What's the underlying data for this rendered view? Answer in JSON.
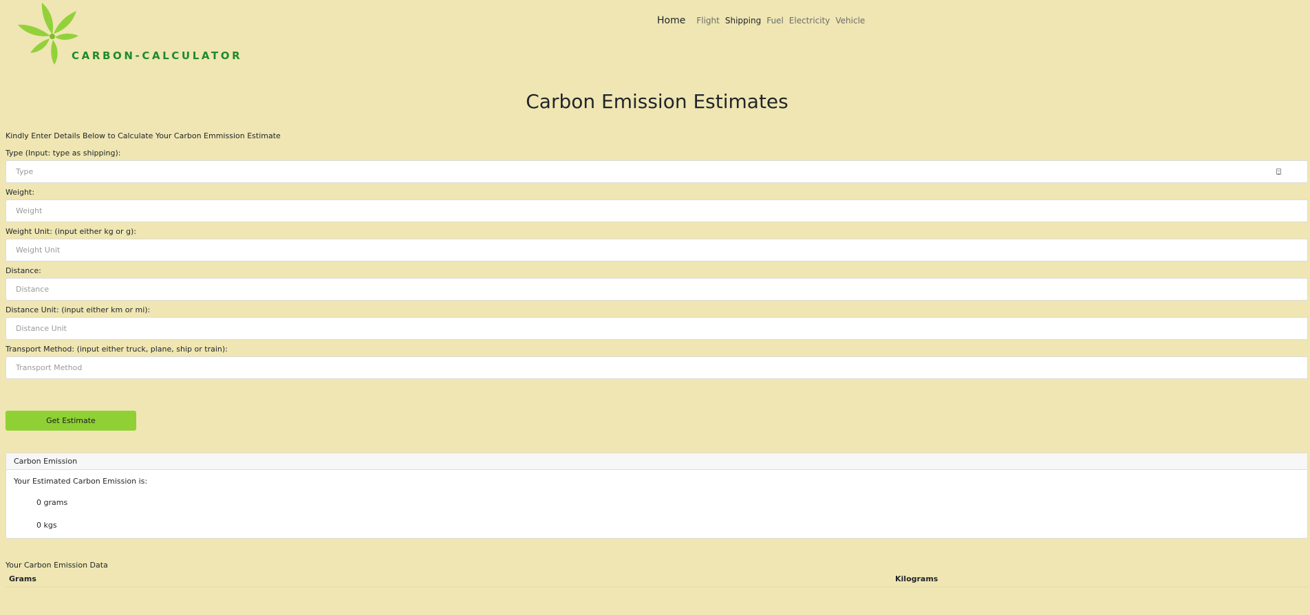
{
  "brand": {
    "name": "CARBON-CALCULATOR",
    "logo_icon": "leaf-logo-icon",
    "colors": {
      "leaf": "#93d13b",
      "text": "#1f8a2c"
    }
  },
  "nav": {
    "items": [
      {
        "label": "Home"
      },
      {
        "label": "Flight"
      },
      {
        "label": "Shipping"
      },
      {
        "label": "Fuel"
      },
      {
        "label": "Electricity"
      },
      {
        "label": "Vehicle"
      }
    ],
    "active": "Shipping"
  },
  "page": {
    "title": "Carbon Emission Estimates",
    "intro": "Kindly Enter Details Below to Calculate Your Carbon Emmission Estimate"
  },
  "form": {
    "type": {
      "label": "Type (Input: type as shipping):",
      "placeholder": "Type",
      "value": ""
    },
    "weight": {
      "label": "Weight:",
      "placeholder": "Weight",
      "value": ""
    },
    "weight_unit": {
      "label": "Weight Unit: (input either kg or g):",
      "placeholder": "Weight Unit",
      "value": ""
    },
    "distance": {
      "label": "Distance:",
      "placeholder": "Distance",
      "value": ""
    },
    "distance_unit": {
      "label": "Distance Unit: (input either km or mi):",
      "placeholder": "Distance Unit",
      "value": ""
    },
    "transport_method": {
      "label": "Transport Method: (input either truck, plane, ship or train):",
      "placeholder": "Transport Method",
      "value": ""
    },
    "submit_label": "Get Estimate",
    "button_color": "#8fd134"
  },
  "result": {
    "header": "Carbon Emission",
    "text": "Your Estimated Carbon Emission is:",
    "grams": "0 grams",
    "kgs": "0 kgs"
  },
  "data_table": {
    "title": "Your Carbon Emission Data",
    "columns": [
      "Grams",
      "Kilograms"
    ]
  },
  "colors": {
    "page_background": "#efe6b3"
  }
}
